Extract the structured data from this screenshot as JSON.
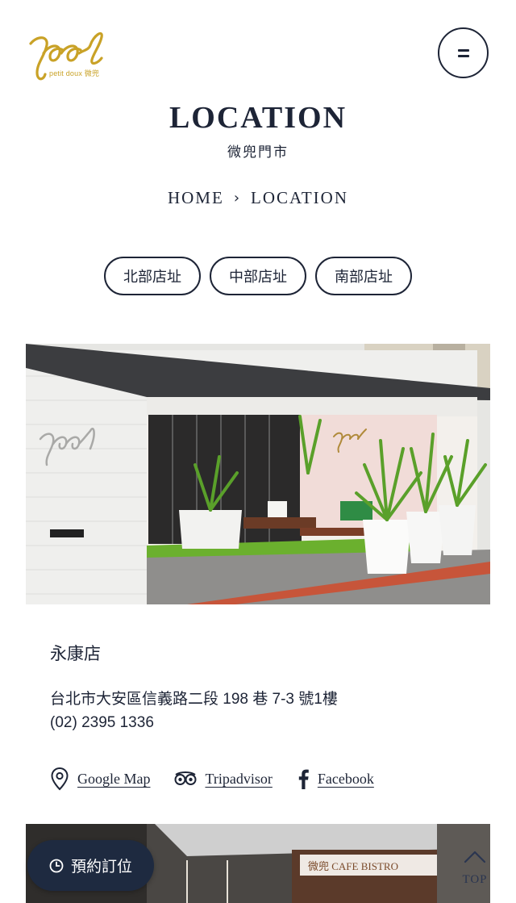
{
  "brand": {
    "tagline": "petit doux 微兜",
    "accent_color": "#c9a227",
    "primary_color": "#1d2436"
  },
  "header": {
    "menu_icon": "hamburger-icon"
  },
  "page": {
    "title": "LOCATION",
    "subtitle": "微兜門市"
  },
  "breadcrumb": {
    "home": "HOME",
    "separator": "›",
    "current": "LOCATION"
  },
  "regions": [
    {
      "label": "北部店址"
    },
    {
      "label": "中部店址"
    },
    {
      "label": "南部店址"
    }
  ],
  "store": {
    "name": "永康店",
    "address": "台北市大安區信義路二段 198 巷 7-3 號1樓",
    "phone": "(02) 2395 1336",
    "links": [
      {
        "label": "Google Map",
        "icon": "map-pin-icon"
      },
      {
        "label": "Tripadvisor",
        "icon": "tripadvisor-icon"
      },
      {
        "label": "Facebook",
        "icon": "facebook-icon"
      }
    ]
  },
  "floating": {
    "reserve_label": "預約訂位",
    "reserve_icon": "clock-icon",
    "top_label": "TOP",
    "top_icon": "chevron-up-icon"
  }
}
